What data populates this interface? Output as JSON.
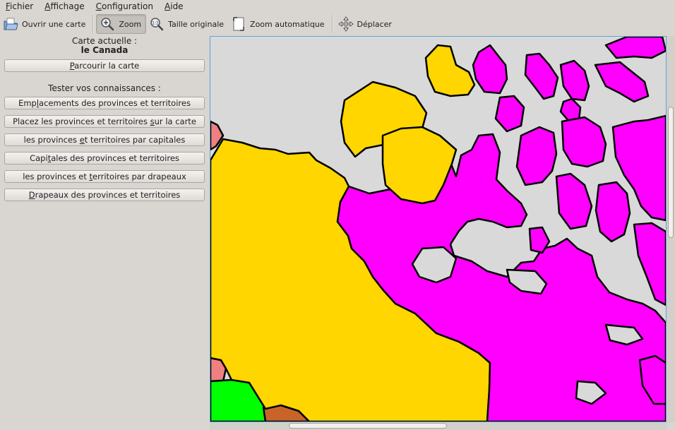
{
  "menu": [
    {
      "mnemonic": "F",
      "rest": "ichier"
    },
    {
      "mnemonic": "A",
      "rest": "ffichage"
    },
    {
      "mnemonic": "C",
      "rest": "onfiguration"
    },
    {
      "mnemonic": "A",
      "rest": "ide"
    }
  ],
  "toolbar": {
    "open_map": "Ouvrir une carte",
    "zoom": "Zoom",
    "original_size": "Taille originale",
    "auto_zoom": "Zoom automatique",
    "move": "Déplacer"
  },
  "side": {
    "current_map_label": "Carte actuelle :",
    "current_map_name": "le Canada",
    "browse": {
      "pre": "",
      "u": "P",
      "post": "arcourir la carte"
    },
    "test_label": "Tester vos connaissances :",
    "quiz": [
      {
        "pre": "Emp",
        "u": "l",
        "post": "acements des provinces et territoires"
      },
      {
        "pre": "Placez les provinces et territoires ",
        "u": "s",
        "post": "ur la carte"
      },
      {
        "pre": "les provinces ",
        "u": "e",
        "post": "t territoires par capitales"
      },
      {
        "pre": "Capi",
        "u": "t",
        "post": "ales des provinces et territoires"
      },
      {
        "pre": "les provinces et ",
        "u": "t",
        "post": "erritoires par drapeaux"
      },
      {
        "pre": "",
        "u": "D",
        "post": "rapeaux des provinces et territoires"
      }
    ]
  },
  "map": {
    "colors": {
      "water": "#d9d9d9",
      "territory_yellow": "#ffd600",
      "territory_magenta": "#ff00ff",
      "salmon": "#f08080",
      "green": "#00ff00",
      "brown": "#c86428",
      "border": "#000000"
    }
  }
}
